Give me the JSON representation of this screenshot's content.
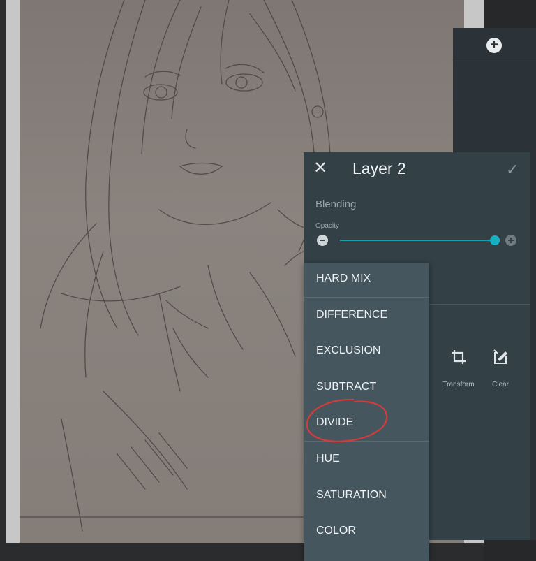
{
  "layer_dialog": {
    "title": "Layer 2",
    "close_icon": "close-icon",
    "confirm_icon": "check-icon",
    "blending_label": "Blending",
    "opacity_label": "Opacity",
    "opacity_value": 1.0,
    "accent_color": "#17b1c3"
  },
  "tools": [
    {
      "label": "Transform",
      "icon": "crop-icon"
    },
    {
      "label": "Clear",
      "icon": "clear-layer-icon"
    }
  ],
  "blend_modes": [
    "HARD MIX",
    "DIFFERENCE",
    "EXCLUSION",
    "SUBTRACT",
    "DIVIDE",
    "HUE",
    "SATURATION",
    "COLOR"
  ],
  "layers_panel": {
    "add_icon": "add-layer-icon"
  },
  "annotation": {
    "circled_item": "DIVIDE",
    "color": "#d83a3a"
  }
}
